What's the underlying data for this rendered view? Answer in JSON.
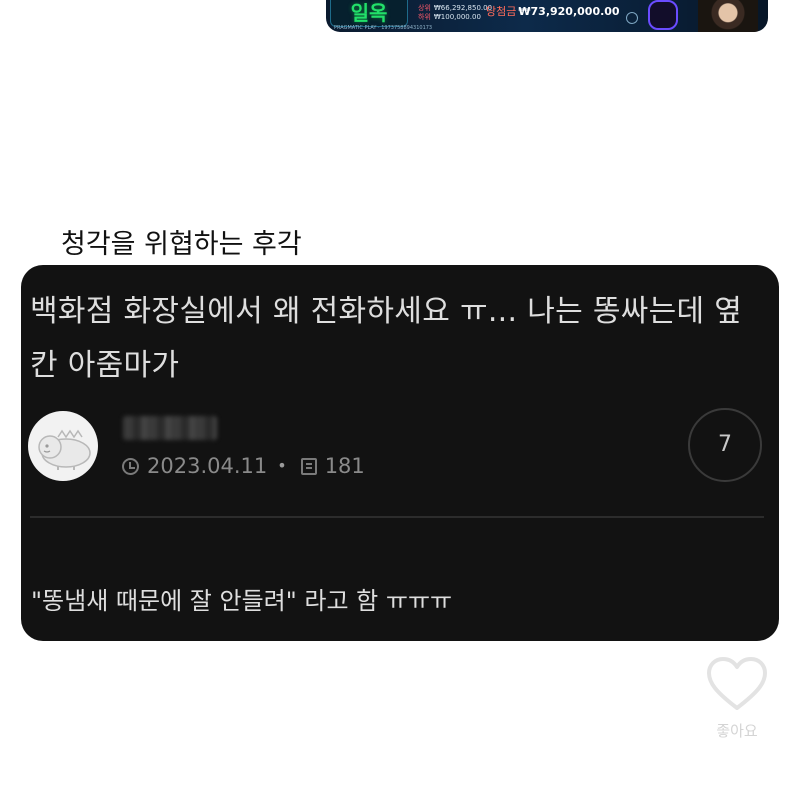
{
  "banner": {
    "logo_text": "일옥",
    "sub_text": "PRAGMATIC PLAY · 1973758894310173",
    "mini_line1_label": "상위",
    "mini_line1_value": "₩66,292,850.00",
    "mini_line2_label": "하위",
    "mini_line2_value": "₩100,000.00",
    "jackpot_label": "당첨금",
    "jackpot_value": "₩73,920,000.00"
  },
  "caption": "청각을 위협하는 후각",
  "post": {
    "title": "백화점 화장실에서 왜 전화하세요 ㅠ... 나는 똥싸는데 옆칸 아줌마가",
    "date": "2023.04.11",
    "views": "181",
    "comment_count": "7",
    "body": "\"똥냄새 때문에 잘 안들려\" 라고 함 ㅠㅠㅠ"
  },
  "like": {
    "label": "좋아요",
    "icon": "heart-icon"
  },
  "colors": {
    "card_bg": "#121212",
    "text_light": "#dedede",
    "meta_gray": "#8a8a8a",
    "banner_green": "#22e06a"
  }
}
